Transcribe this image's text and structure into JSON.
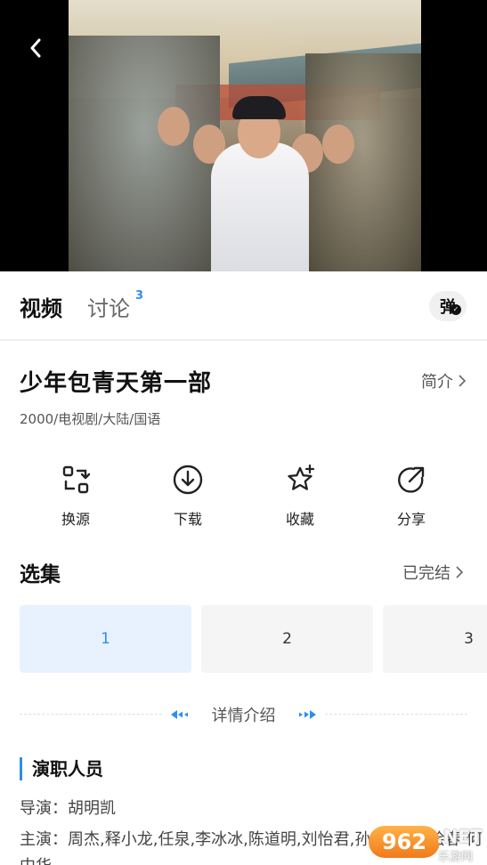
{
  "player": {
    "back_icon": "chevron-left-icon"
  },
  "tabs": {
    "video_label": "视频",
    "discuss_label": "讨论",
    "discuss_count": "3",
    "danmaku_label": "弹"
  },
  "show": {
    "title": "少年包青天第一部",
    "intro_label": "简介",
    "meta": "2000/电视剧/大陆/国语"
  },
  "actions": [
    {
      "label": "换源",
      "icon": "switch-source-icon"
    },
    {
      "label": "下载",
      "icon": "download-icon"
    },
    {
      "label": "收藏",
      "icon": "star-add-icon"
    },
    {
      "label": "分享",
      "icon": "share-icon"
    }
  ],
  "episodes": {
    "title": "选集",
    "status": "已完结",
    "items": [
      "1",
      "2",
      "3"
    ],
    "selected": "1"
  },
  "detail": {
    "divider_label": "详情介绍"
  },
  "cast": {
    "heading": "演职人员",
    "director": "导演：胡明凯",
    "actors": "主演：周杰,释小龙,任泉,李冰冰,陈道明,刘怡君,孙菂,佩 王绘春 何中华"
  },
  "watermark": {
    "badge": "962",
    "net": ".NET",
    "sub": "乐游网"
  },
  "colors": {
    "accent": "#2b8ef0",
    "selected_bg": "#e8f2fe"
  }
}
